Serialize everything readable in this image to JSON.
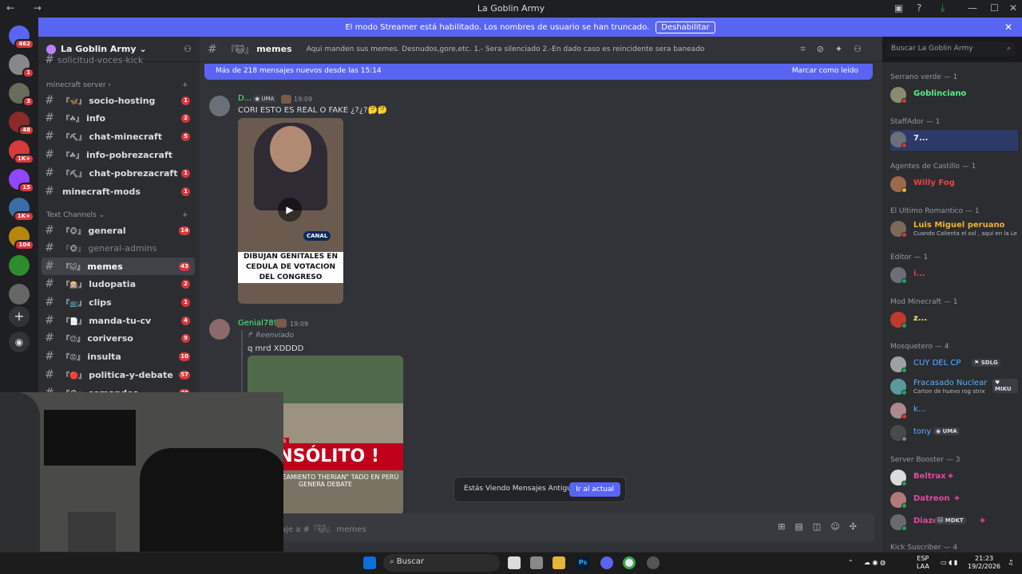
{
  "window": {
    "title": "La Goblin Army",
    "nav": "← →"
  },
  "banner": {
    "message": "El modo Streamer está habilitado. Los nombres de usuario se han truncado.",
    "button": "Deshabilitar",
    "close": "✕"
  },
  "guild_badges": [
    "462",
    "1",
    "3",
    "48",
    "1K+",
    "15",
    "1K+",
    "104"
  ],
  "server": {
    "name": "La Goblin Army",
    "chevron": "⌄",
    "add_icon": "person-add-icon"
  },
  "sidebar": {
    "truncated_top": "solicitud-voces-kick",
    "cat_minecraft": "minecraft server",
    "cat_text": "Text Channels",
    "minecraft_channels": [
      {
        "emoji": "『🦋』",
        "name": "socio-hosting",
        "count": "1"
      },
      {
        "emoji": "『☘』",
        "name": "info",
        "count": "2"
      },
      {
        "emoji": "『⛏』",
        "name": "chat-minecraft",
        "count": "5"
      },
      {
        "emoji": "『☘』",
        "name": "info-pobrezacraft",
        "count": ""
      },
      {
        "emoji": "『⛏』",
        "name": "chat-pobrezacraft",
        "count": "1"
      },
      {
        "emoji": "",
        "name": "minecraft-mods",
        "count": "1"
      }
    ],
    "text_channels": [
      {
        "emoji": "『🐵』",
        "name": "general",
        "count": "14",
        "state": "unread"
      },
      {
        "emoji": "『🐵』",
        "name": "general-admins",
        "count": "",
        "state": "muted"
      },
      {
        "emoji": "『🐱』",
        "name": "memes",
        "count": "43",
        "state": "active"
      },
      {
        "emoji": "『🎰』",
        "name": "ludopatia",
        "count": "2",
        "state": "unread"
      },
      {
        "emoji": "『📺』",
        "name": "clips",
        "count": "1",
        "state": "unread"
      },
      {
        "emoji": "『📄』",
        "name": "manda-tu-cv",
        "count": "4",
        "state": "unread"
      },
      {
        "emoji": "『😊』",
        "name": "coriverso",
        "count": "9",
        "state": "unread"
      },
      {
        "emoji": "『😡』",
        "name": "insulta",
        "count": "10",
        "state": "unread"
      },
      {
        "emoji": "『🔴』",
        "name": "politica-y-debate",
        "count": "57",
        "state": "unread"
      },
      {
        "emoji": "『🐵』",
        "name": "comandos",
        "count": "26",
        "state": "unread"
      }
    ]
  },
  "channel": {
    "emoji": "『🐱』",
    "name": "memes",
    "topic": "Aqui manden sus memes. Desnudos,gore,etc. 1.- Sera silenciado 2.-En dado caso es reincidente sera baneado",
    "search_placeholder": "Buscar La Goblin Army"
  },
  "new_messages": {
    "text": "Más de 218 mensajes nuevos desde las 15:14",
    "mark": "Marcar como leído"
  },
  "messages": [
    {
      "user": "D...",
      "tag": "UMA",
      "time": "19:09",
      "text": "CORI ESTO ES REAL O FAKE ¿?¿?🤔🤔",
      "caption": "DIBUJAN GENITALES EN CEDULA DE VOTACION DEL CONGRESO",
      "logo": "CANAL"
    },
    {
      "user": "Genial789",
      "time": "19:09",
      "forwarded": "Reenviado",
      "text": "q mrd XDDDD",
      "headline": "INSÓLITO !",
      "kicker": "THERIANS",
      "sub": "ER \"APAREAMIENTO THERIAN\" TADO EN PERÚ GENERA DEBATE"
    }
  ],
  "old_messages": {
    "text": "Estás Viendo Mensajes Antiguos",
    "button": "Ir al actual"
  },
  "composer": {
    "placeholder": "aje a #『🐱』 memes"
  },
  "members": {
    "groups": [
      {
        "label": "Serrano verde — 1"
      },
      {
        "label": "StaffAdor — 1"
      },
      {
        "label": "Agentes de Castillo — 1"
      },
      {
        "label": "El Ultimo Romantico — 1"
      },
      {
        "label": "Editor — 1"
      },
      {
        "label": "Mod Minecraft — 1"
      },
      {
        "label": "Mosquetero — 4"
      },
      {
        "label": "Server Booster — 3"
      },
      {
        "label": "Kick Suscriber — 4"
      }
    ],
    "list": [
      {
        "name": "Goblinciano",
        "color": "#57f287",
        "status": "",
        "tag": ""
      },
      {
        "name": "7...",
        "color": "#f2f3f5",
        "status": "",
        "tag": ""
      },
      {
        "name": "Willy Fog",
        "color": "#ed4245",
        "status": "",
        "tag": ""
      },
      {
        "name": "Luis Miguel peruano",
        "color": "#f0b232",
        "status": "Cuando Calienta el sol , aqui en la Le",
        "tag": ""
      },
      {
        "name": "i...",
        "color": "#ed4245",
        "status": "",
        "tag": ""
      },
      {
        "name": "z...",
        "color": "#fee75c",
        "status": "",
        "tag": ""
      },
      {
        "name": "CUY DEL CP",
        "color": "#5ab0ff",
        "status": "",
        "tag": "SDLG"
      },
      {
        "name": "Fracasado Nuclear",
        "color": "#5ab0ff",
        "status": "Carton de huevo rog strix",
        "tag": "MIKU"
      },
      {
        "name": "k...",
        "color": "#5ab0ff",
        "status": "",
        "tag": ""
      },
      {
        "name": "tony",
        "color": "#5ab0ff",
        "status": "",
        "tag": "UMA"
      },
      {
        "name": "Beltrax",
        "color": "#eb459e",
        "status": "",
        "tag": ""
      },
      {
        "name": "Datreon",
        "color": "#eb459e",
        "status": "",
        "tag": ""
      },
      {
        "name": "Diaze",
        "color": "#eb459e",
        "status": "",
        "tag": "MDKT"
      }
    ]
  },
  "taskbar": {
    "search": "Buscar",
    "lang": "ESP",
    "lang2": "LAA",
    "time": "21:23",
    "date": "19/2/2026",
    "ps": "Ps"
  }
}
